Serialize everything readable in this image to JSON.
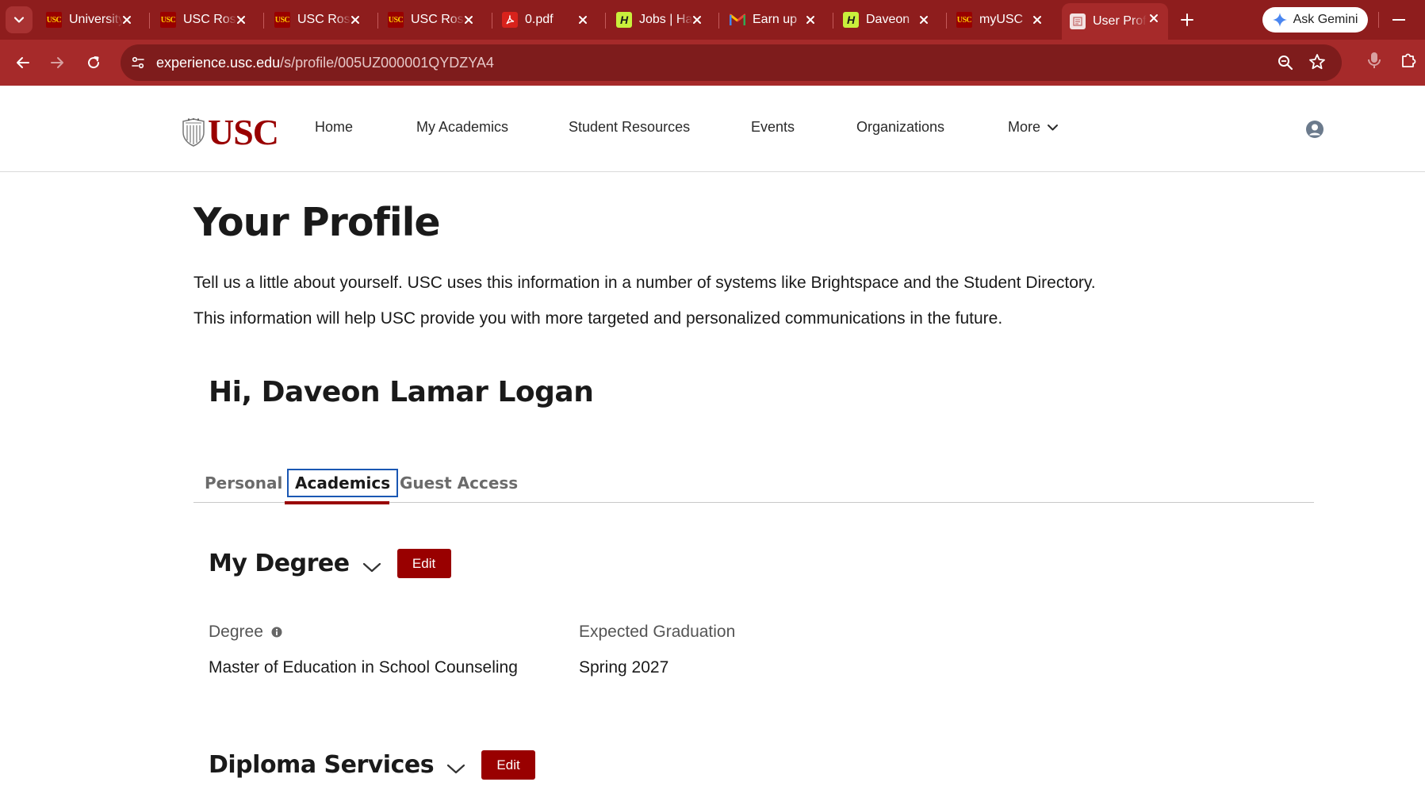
{
  "browser": {
    "tabs": [
      {
        "title": "University",
        "favicon": "usc-icon",
        "active": false
      },
      {
        "title": "USC Roster",
        "favicon": "usc-icon",
        "active": false
      },
      {
        "title": "USC Roster",
        "favicon": "usc-icon",
        "active": false
      },
      {
        "title": "USC Roster",
        "favicon": "usc-icon",
        "active": false
      },
      {
        "title": "0.pdf",
        "favicon": "pdf-icon",
        "active": false
      },
      {
        "title": "Jobs | Handshake",
        "favicon": "handshake-icon",
        "active": false
      },
      {
        "title": "Earn up",
        "favicon": "gmail-icon",
        "active": false
      },
      {
        "title": "Daveon",
        "favicon": "handshake-icon",
        "active": false
      },
      {
        "title": "myUSC",
        "favicon": "usc-icon",
        "active": false
      },
      {
        "title": "User Profile",
        "favicon": "page-icon",
        "active": true
      }
    ],
    "gemini_label": "Ask Gemini",
    "url_host": "experience.usc.edu",
    "url_path": "/s/profile/005UZ000001QYDZYA4",
    "colors": {
      "chrome": "#8e1d1d",
      "toolbar": "#a62a2a",
      "omnibox": "#7e1c1c"
    }
  },
  "site": {
    "logo_text": "USC",
    "nav": {
      "home": "Home",
      "academics": "My Academics",
      "resources": "Student Resources",
      "events": "Events",
      "organizations": "Organizations",
      "more": "More"
    },
    "brand_color": "#990000"
  },
  "page": {
    "title": "Your Profile",
    "intro_1": "Tell us a little about yourself. USC uses this information in a number of systems like Brightspace and the Student Directory.",
    "intro_2": "This information will help USC provide you with more targeted and personalized communications in the future.",
    "greeting": "Hi, Daveon Lamar Logan",
    "tabs": {
      "personal": "Personal",
      "academics": "Academics",
      "guest": "Guest Access",
      "active": "academics"
    },
    "degree_section": {
      "title": "My Degree",
      "edit_label": "Edit",
      "degree_label": "Degree",
      "degree_value": "Master of Education in School Counseling",
      "graduation_label": "Expected Graduation",
      "graduation_value": "Spring 2027"
    },
    "diploma_section": {
      "title": "Diploma Services",
      "edit_label": "Edit"
    }
  }
}
